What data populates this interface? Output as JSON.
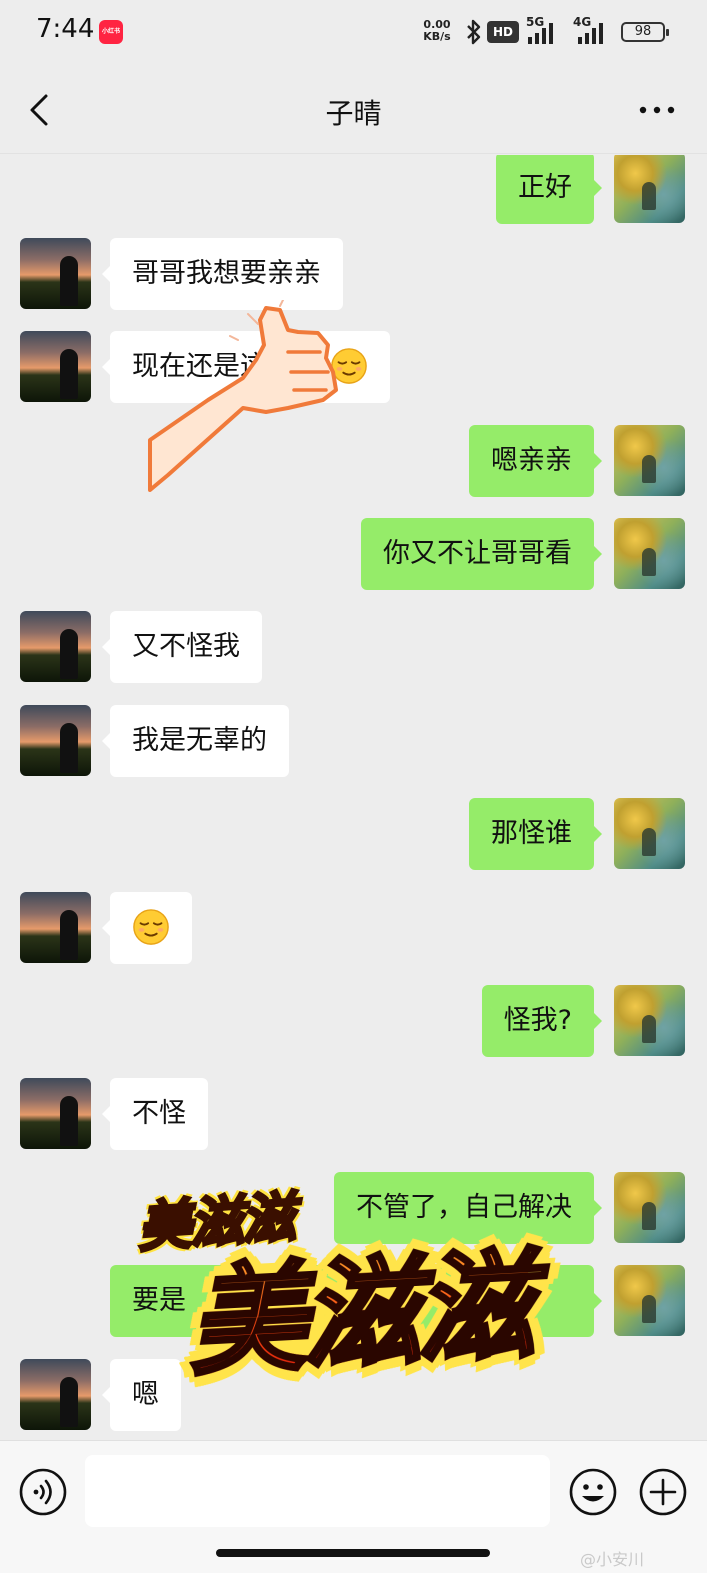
{
  "status_bar": {
    "time": "7:44",
    "app_badge": "小红书",
    "net_speed_value": "0.00",
    "net_speed_unit": "KB/s",
    "hd_label": "HD",
    "network_1": "5G",
    "network_2": "4G",
    "battery": "98"
  },
  "header": {
    "title": "子晴",
    "back_icon": "chevron-left-icon",
    "more_icon": "more-dots-icon"
  },
  "messages": [
    {
      "side": "right",
      "text": "正好"
    },
    {
      "side": "left",
      "text": "哥哥我想要亲亲"
    },
    {
      "side": "left",
      "text": "现在还是这样的",
      "emoji": "smirk-face"
    },
    {
      "side": "right",
      "text": "嗯亲亲"
    },
    {
      "side": "right",
      "text": "你又不让哥哥看"
    },
    {
      "side": "left",
      "text": "又不怪我"
    },
    {
      "side": "left",
      "text": "我是无辜的"
    },
    {
      "side": "right",
      "text": "那怪谁"
    },
    {
      "side": "left",
      "text": "",
      "emoji": "smirk-face"
    },
    {
      "side": "right",
      "text": "怪我?"
    },
    {
      "side": "left",
      "text": "不怪"
    },
    {
      "side": "right",
      "text": "不管了，自己解决"
    },
    {
      "side": "right",
      "text": "要是"
    },
    {
      "side": "left",
      "text": "嗯"
    }
  ],
  "stickers": {
    "small": "美滋滋",
    "big": "美滋滋",
    "thumb": "thumbs-up-icon"
  },
  "input_bar": {
    "voice_icon": "voice-icon",
    "emoji_icon": "emoji-icon",
    "plus_icon": "plus-icon",
    "input_value": "",
    "watermark": "@小安川"
  },
  "colors": {
    "background": "#ededed",
    "my_bubble": "#95ec69",
    "their_bubble": "#ffffff"
  }
}
